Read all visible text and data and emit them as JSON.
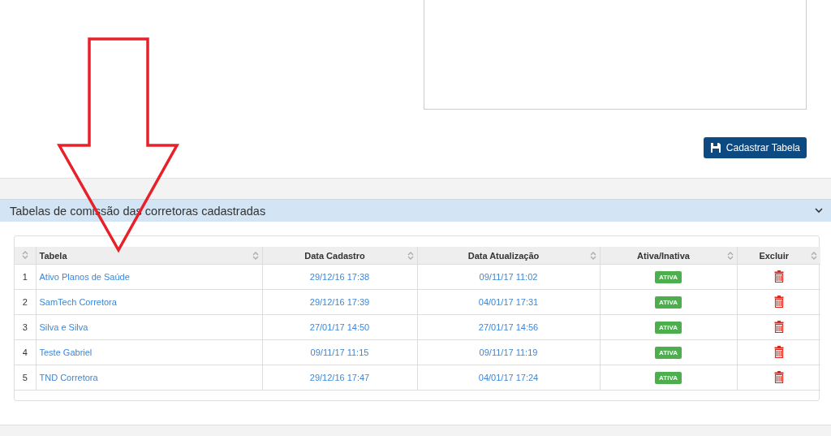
{
  "form": {
    "button": "Cadastrar Tabela"
  },
  "panel": {
    "title": "Tabelas de comissão das corretoras cadastradas",
    "expanded": true
  },
  "table": {
    "columns": [
      "Tabela",
      "Data Cadastro",
      "Data Atualização",
      "Ativa/Inativa",
      "Excluir"
    ],
    "rows": [
      {
        "index": "1",
        "name": "Ativo Planos de Saúde",
        "created": "29/12/16 17:38",
        "updated": "09/11/17 11:02",
        "status": "ATIVA"
      },
      {
        "index": "2",
        "name": "SamTech Corretora",
        "created": "29/12/16 17:39",
        "updated": "04/01/17 17:31",
        "status": "ATIVA"
      },
      {
        "index": "3",
        "name": "Silva e Silva",
        "created": "27/01/17 14:50",
        "updated": "27/01/17 14:56",
        "status": "ATIVA"
      },
      {
        "index": "4",
        "name": "Teste Gabriel",
        "created": "09/11/17 11:15",
        "updated": "09/11/17 11:19",
        "status": "ATIVA"
      },
      {
        "index": "5",
        "name": "TND Corretora",
        "created": "29/12/16 17:47",
        "updated": "04/01/17 17:24",
        "status": "ATIVA"
      }
    ]
  }
}
